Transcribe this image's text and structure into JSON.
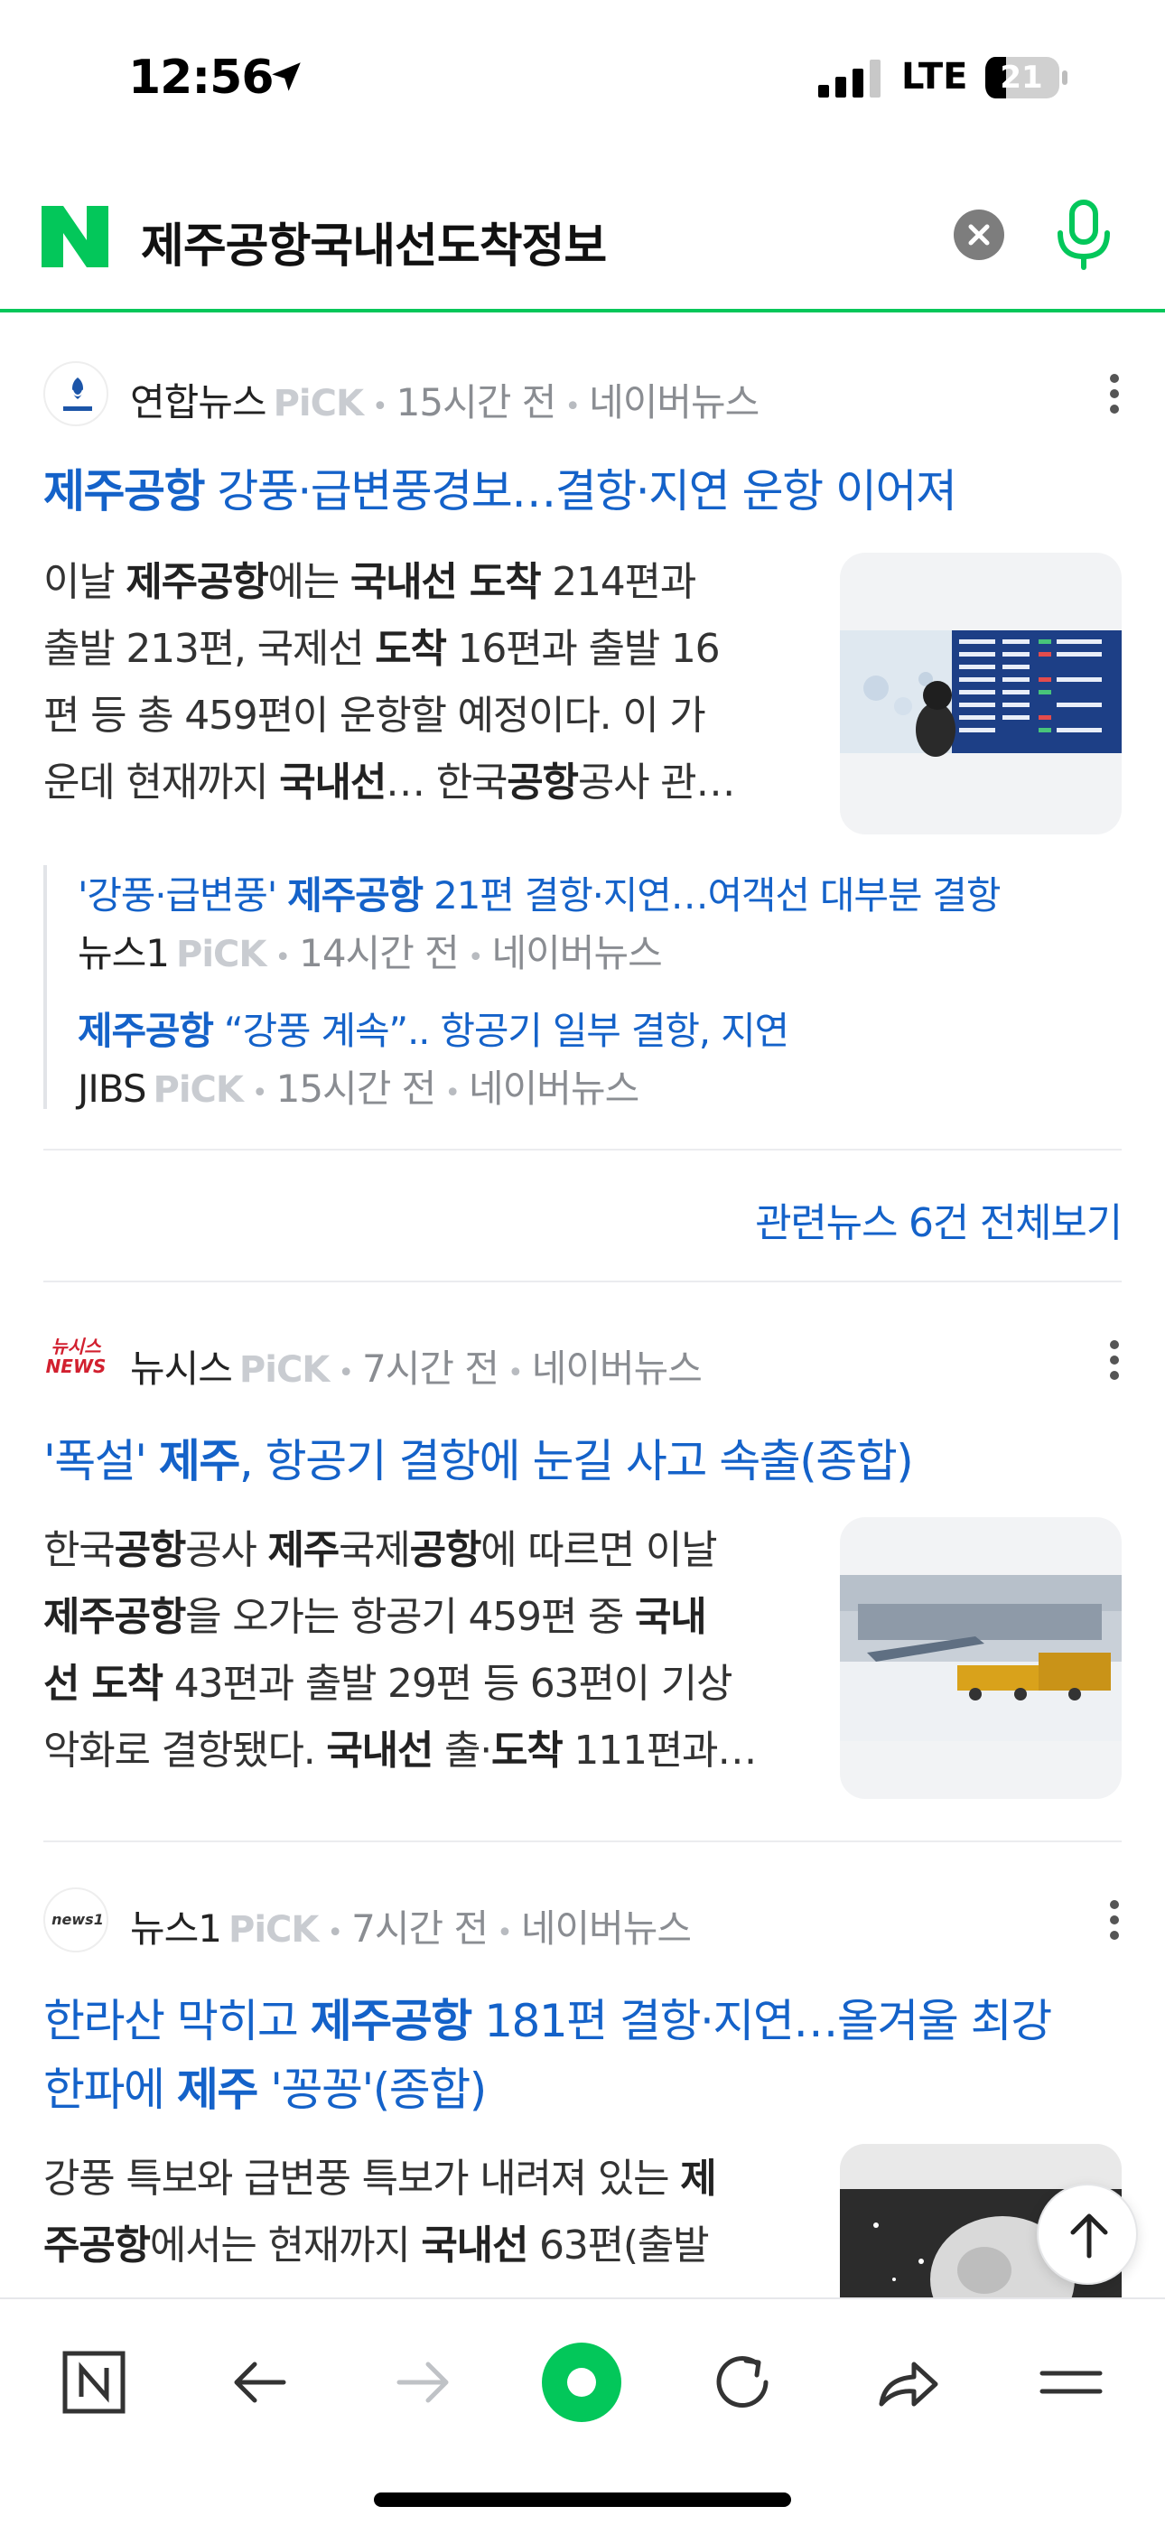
{
  "status": {
    "time": "12:56",
    "network": "LTE",
    "battery": "21"
  },
  "search": {
    "query": "제주공항국내선도착정보"
  },
  "news": [
    {
      "press": "연합뉴스",
      "pick": "PiCK",
      "time": "15시간 전",
      "source": "네이버뉴스",
      "headline_parts": [
        "제주공항",
        " 강풍·급변풍경보…결항·지연 운항 이어져"
      ],
      "summary_lines": [
        [
          "이날 ",
          "제주공항",
          "에는 ",
          "국내선 도착",
          " 214편과"
        ],
        [
          "출발 213편, 국제선 ",
          "도착",
          " 16편과 출발 16"
        ],
        [
          "편 등 총 459편이 운항할 예정이다. 이 가"
        ],
        [
          "운데 현재까지 ",
          "국내선",
          "… 한국",
          "공항",
          "공사 관…"
        ]
      ],
      "related": [
        {
          "title_parts": [
            "'강풍·급변풍' ",
            "제주공항",
            " 21편 결항·지연…여객선 대부분 결항"
          ],
          "press": "뉴스1",
          "pick": "PiCK",
          "time": "14시간 전",
          "source": "네이버뉴스"
        },
        {
          "title_parts": [
            "제주공항",
            " “강풍 계속”.. 항공기 일부 결항, 지연"
          ],
          "press": "JIBS",
          "pick": "PiCK",
          "time": "15시간 전",
          "source": "네이버뉴스"
        }
      ],
      "related_all": "관련뉴스 6건 전체보기"
    },
    {
      "press": "뉴시스",
      "press_logo_text_1": "뉴시스",
      "press_logo_text_2": "NEWS",
      "pick": "PiCK",
      "time": "7시간 전",
      "source": "네이버뉴스",
      "headline_parts": [
        "'폭설' ",
        "제주",
        ", 항공기 결항에 눈길 사고 속출(종합)"
      ],
      "summary_lines": [
        [
          "한국",
          "공항",
          "공사 ",
          "제주",
          "국제",
          "공항",
          "에 따르면 이날"
        ],
        [
          "제주공항",
          "을 오가는 항공기 459편 중 ",
          "국내"
        ],
        [
          "선 도착",
          " 43편과 출발 29편 등 63편이 기상"
        ],
        [
          "악화로 결항됐다. ",
          "국내선",
          " 출·",
          "도착",
          " 111편과…"
        ]
      ]
    },
    {
      "press": "뉴스1",
      "press_logo_text_1": "news1",
      "pick": "PiCK",
      "time": "7시간 전",
      "source": "네이버뉴스",
      "headline_line1": [
        "한라산 막히고 ",
        "제주공항",
        " 181편 결항·지연…올겨울 최강"
      ],
      "headline_line2": [
        "한파에 ",
        "제주",
        " '꽁꽁'(종합)"
      ],
      "summary_lines": [
        [
          "강풍 특보와 급변풍 특보가 내려져 있는 ",
          "제"
        ],
        [
          "주공항",
          "에서는 현재까지 ",
          "국내선",
          " 63편(출발"
        ]
      ]
    }
  ],
  "colors": {
    "naver_green": "#03c75a",
    "link_blue": "#1462c9",
    "meta_gray": "#8a8d92"
  },
  "icons": [
    "location-arrow-icon",
    "signal-icon",
    "battery-icon",
    "naver-logo",
    "clear-icon",
    "mic-icon",
    "more-icon",
    "scroll-top-icon",
    "home-n-icon",
    "back-icon",
    "forward-icon",
    "green-dot-icon",
    "reload-icon",
    "share-icon",
    "menu-icon"
  ]
}
